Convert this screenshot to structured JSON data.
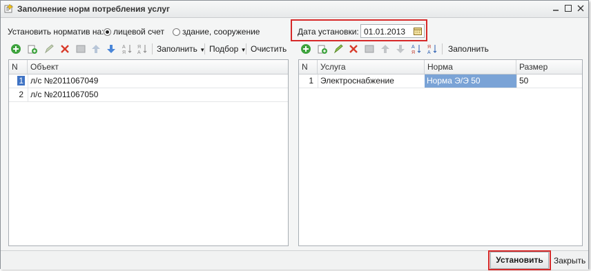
{
  "window": {
    "title": "Заполнение норм потребления услуг"
  },
  "header": {
    "norm_label": "Установить норматив на:",
    "radio_account": "лицевой счет",
    "radio_building": "здание, сооружение",
    "date_label": "Дата установки:",
    "date_value": "01.01.2013"
  },
  "left_toolbar": {
    "fill": "Заполнить",
    "select": "Подбор",
    "clear": "Очистить"
  },
  "right_toolbar": {
    "fill": "Заполнить"
  },
  "left_table": {
    "columns": [
      "N",
      "Объект"
    ],
    "rows": [
      {
        "n": "1",
        "object": "л/с №2011067049"
      },
      {
        "n": "2",
        "object": "л/с №2011067050"
      }
    ]
  },
  "right_table": {
    "columns": [
      "N",
      "Услуга",
      "Норма",
      "Размер"
    ],
    "rows": [
      {
        "n": "1",
        "service": "Электроснабжение",
        "norm": "Норма Э/Э 50",
        "size": "50"
      }
    ]
  },
  "footer": {
    "set_button": "Установить",
    "close_button": "Закрыть"
  },
  "colors": {
    "highlight": "#d62828",
    "selected_cell": "#7aa3d6",
    "active_row_num": "#3f73c4"
  }
}
